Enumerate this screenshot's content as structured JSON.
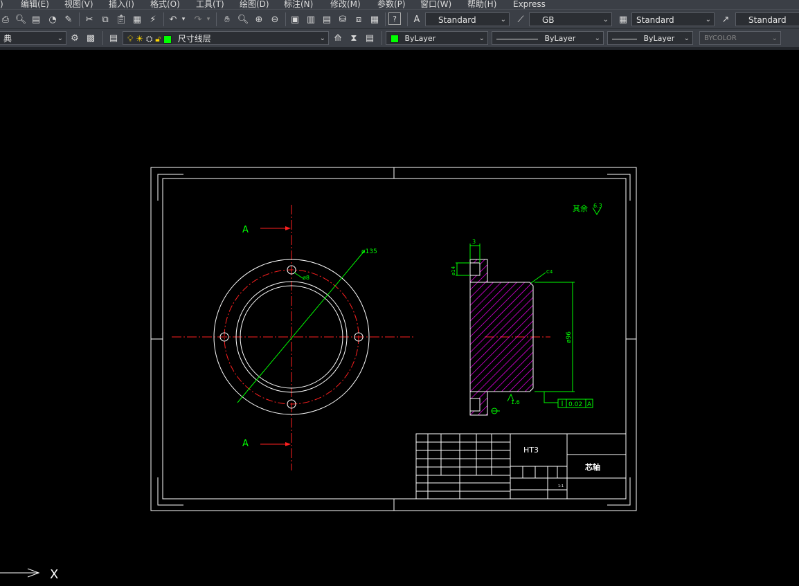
{
  "menu": {
    "items": [
      "编辑(E)",
      "视图(V)",
      "插入(I)",
      "格式(O)",
      "工具(T)",
      "绘图(D)",
      "标注(N)",
      "修改(M)",
      "参数(P)",
      "窗口(W)",
      "帮助(H)",
      "Express"
    ],
    "leading": ")"
  },
  "styles_toolbar": {
    "text_style": "Standard",
    "dim_style": "GB",
    "table_style": "Standard",
    "multileader_style": "Standard"
  },
  "layers_toolbar": {
    "workspace": "典",
    "current_layer": "尺寸线层",
    "layer_color": "#00ff00"
  },
  "properties_toolbar": {
    "color": "ByLayer",
    "linetype": "ByLayer",
    "lineweight": "ByLayer",
    "plot_style": "BYCOLOR"
  },
  "drawing": {
    "section_label_top": "A",
    "section_label_bottom": "A",
    "dim_outer_dia": "ø135",
    "dim_hole_dia": "ø8",
    "dim_flange_thk": "3",
    "dim_step_dia": "ø14",
    "dim_chamfer": "C4",
    "dim_shaft_dia": "ø96",
    "roughness_value": "1.6",
    "tolerance_value": "0.02",
    "datum": "A",
    "surface_note": "其余",
    "surface_note_value": "6.3",
    "title_block": {
      "material": "HT3",
      "part_name": "芯轴",
      "scale": "1:1"
    }
  },
  "ucs": {
    "x_label": "X"
  }
}
